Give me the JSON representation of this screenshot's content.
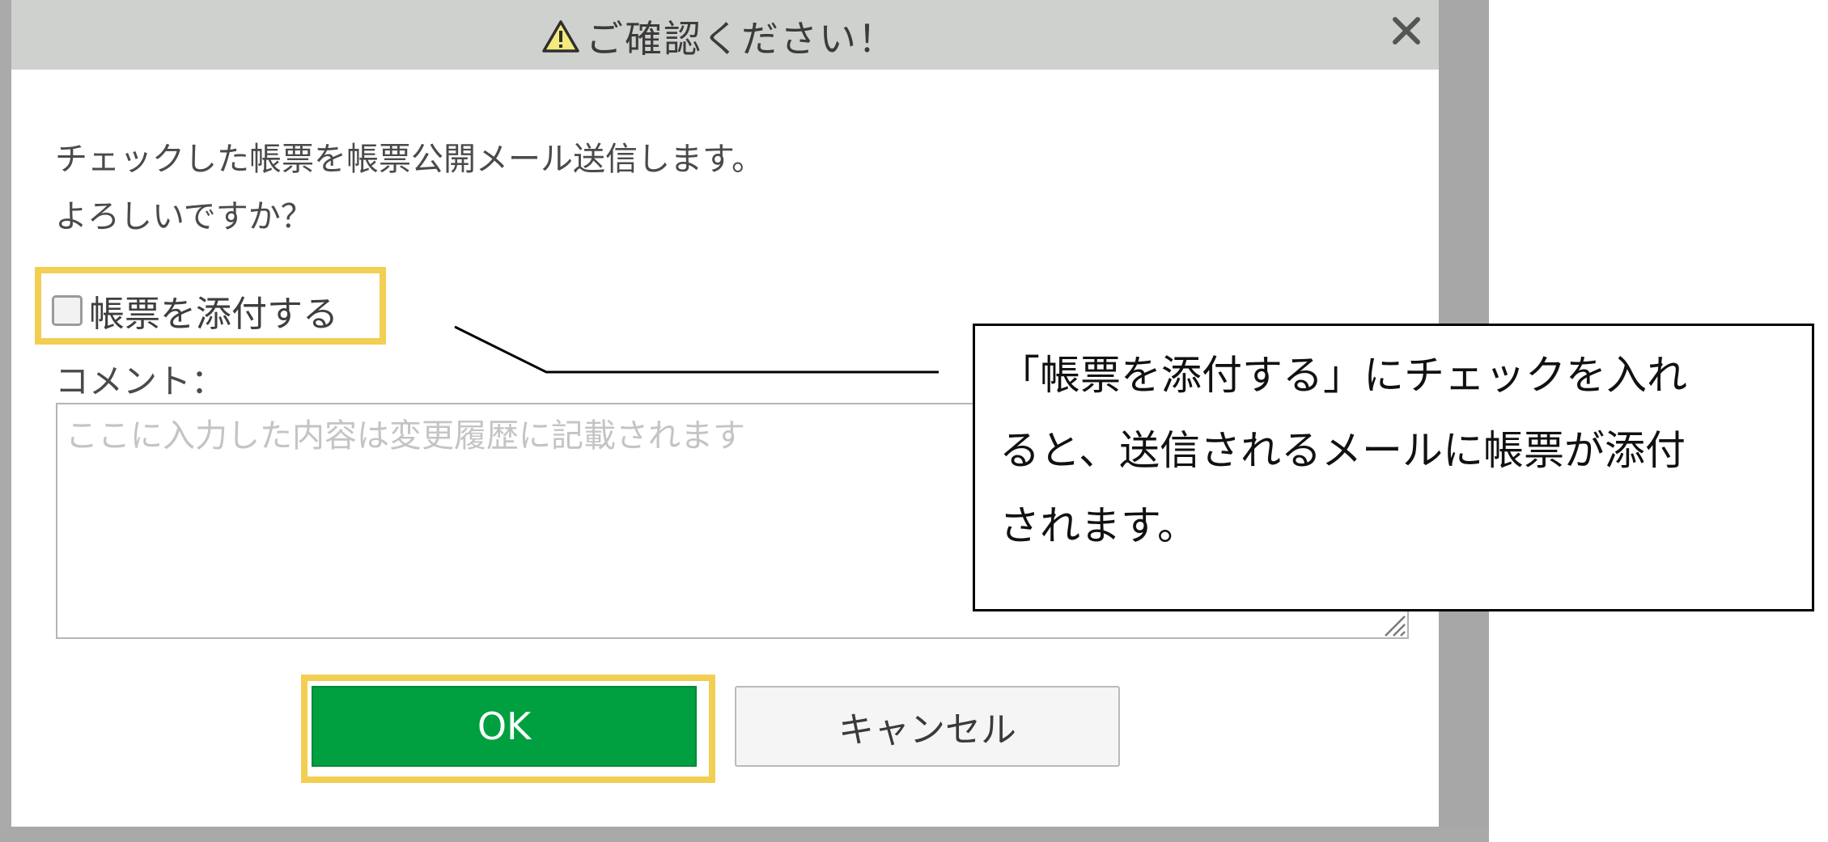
{
  "dialog": {
    "title": "ご確認ください！",
    "title_icon": "warning-icon",
    "close_icon": "close-icon",
    "message_lines": [
      "チェックした帳票を帳票公開メール送信します。",
      "よろしいですか？"
    ],
    "attach_checkbox": {
      "label": "帳票を添付する",
      "checked": false
    },
    "comment": {
      "label": "コメント：",
      "placeholder": "ここに入力した内容は変更履歴に記載されます",
      "value": ""
    },
    "buttons": {
      "ok_label": "OK",
      "cancel_label": "キャンセル"
    }
  },
  "annotation": {
    "lines": [
      "「帳票を添付する」にチェックを入れ",
      "ると、送信されるメールに帳票が添付",
      "されます。"
    ]
  },
  "colors": {
    "titlebar": "#ced1ce",
    "ok_button": "#00a040",
    "highlight": "#f2cf52",
    "backdrop": "#a6a7a6"
  }
}
